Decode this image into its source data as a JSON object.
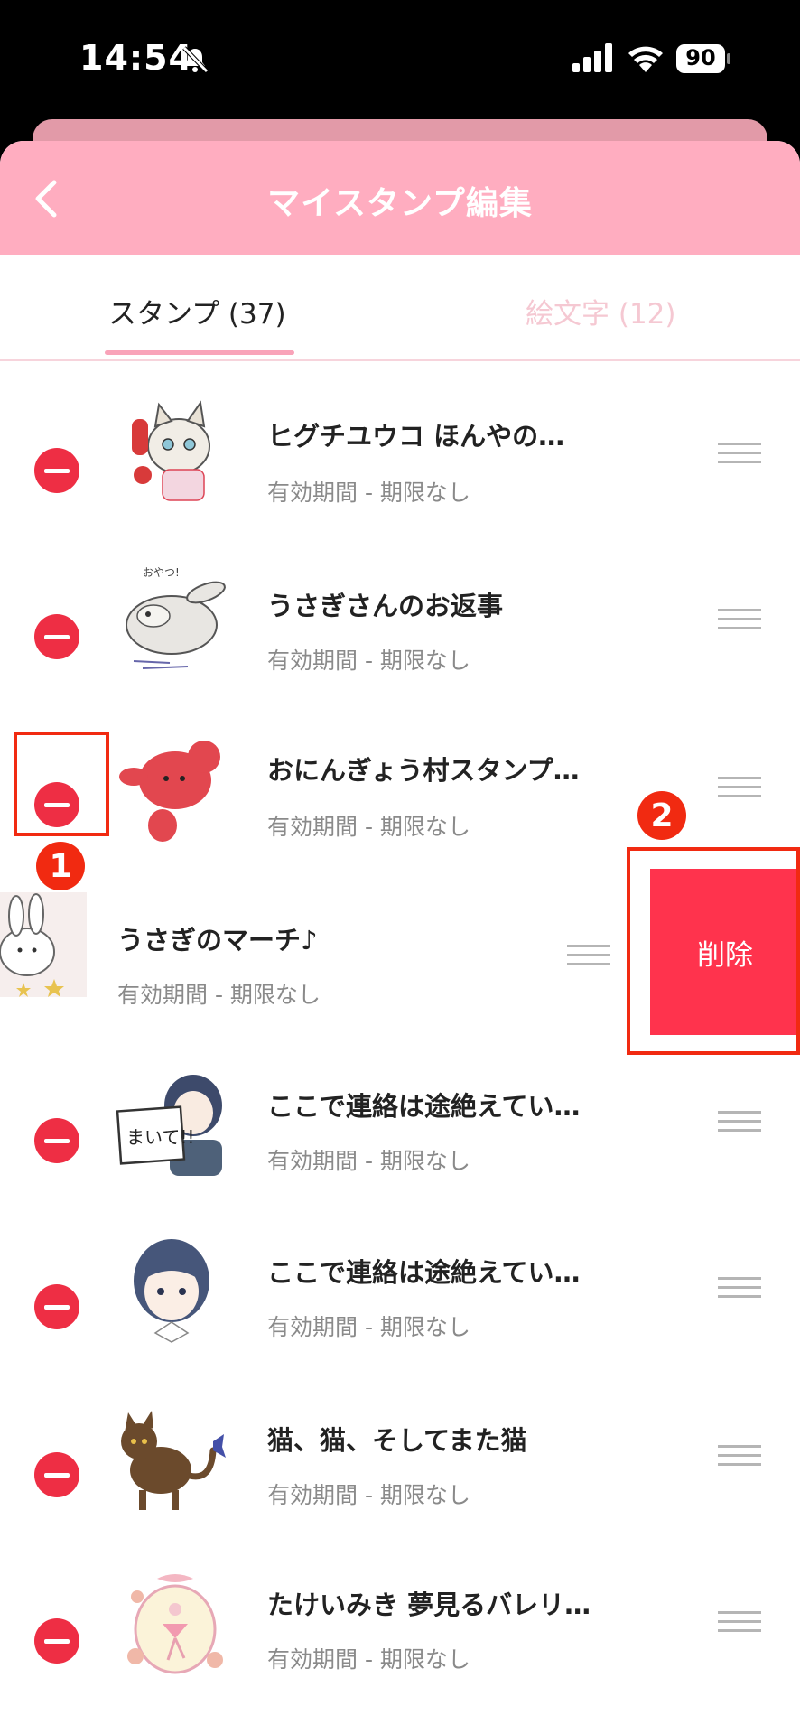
{
  "status_bar": {
    "time": "14:54",
    "battery": "90"
  },
  "header": {
    "title": "マイスタンプ編集"
  },
  "tabs": [
    {
      "label": "スタンプ (37)",
      "active": true
    },
    {
      "label": "絵文字 (12)",
      "active": false
    }
  ],
  "items": [
    {
      "name": "ヒグチユウコ ほんやの…",
      "validity": "有効期間 - 期限なし",
      "thumb": "cat-phone-sticker-icon"
    },
    {
      "name": "うさぎさんのお返事",
      "validity": "有効期間 - 期限なし",
      "thumb": "rabbit-sticker-icon"
    },
    {
      "name": "おにんぎょう村スタンプ…",
      "validity": "有効期間 - 期限なし",
      "thumb": "red-doll-sticker-icon"
    },
    {
      "name": "うさぎのマーチ♪",
      "validity": "有効期間 - 期限なし",
      "thumb": "bunny-stars-sticker-icon"
    },
    {
      "name": "ここで連絡は途絶えてい…",
      "validity": "有効期間 - 期限なし",
      "thumb": "girl-sign-sticker-icon"
    },
    {
      "name": "ここで連絡は途絶えてい…",
      "validity": "有効期間 - 期限なし",
      "thumb": "girl-face-sticker-icon"
    },
    {
      "name": "猫、猫、そしてまた猫",
      "validity": "有効期間 - 期限なし",
      "thumb": "cat-butterfly-sticker-icon"
    },
    {
      "name": "たけいみき 夢見るバレリ…",
      "validity": "有効期間 - 期限なし",
      "thumb": "ballerina-sticker-icon"
    }
  ],
  "delete_label": "削除",
  "annotations": [
    "1",
    "2"
  ],
  "colors": {
    "header": "#ffadc0",
    "delete": "#ff334d",
    "minus": "#ee2e44",
    "annotation": "#f12a11"
  }
}
